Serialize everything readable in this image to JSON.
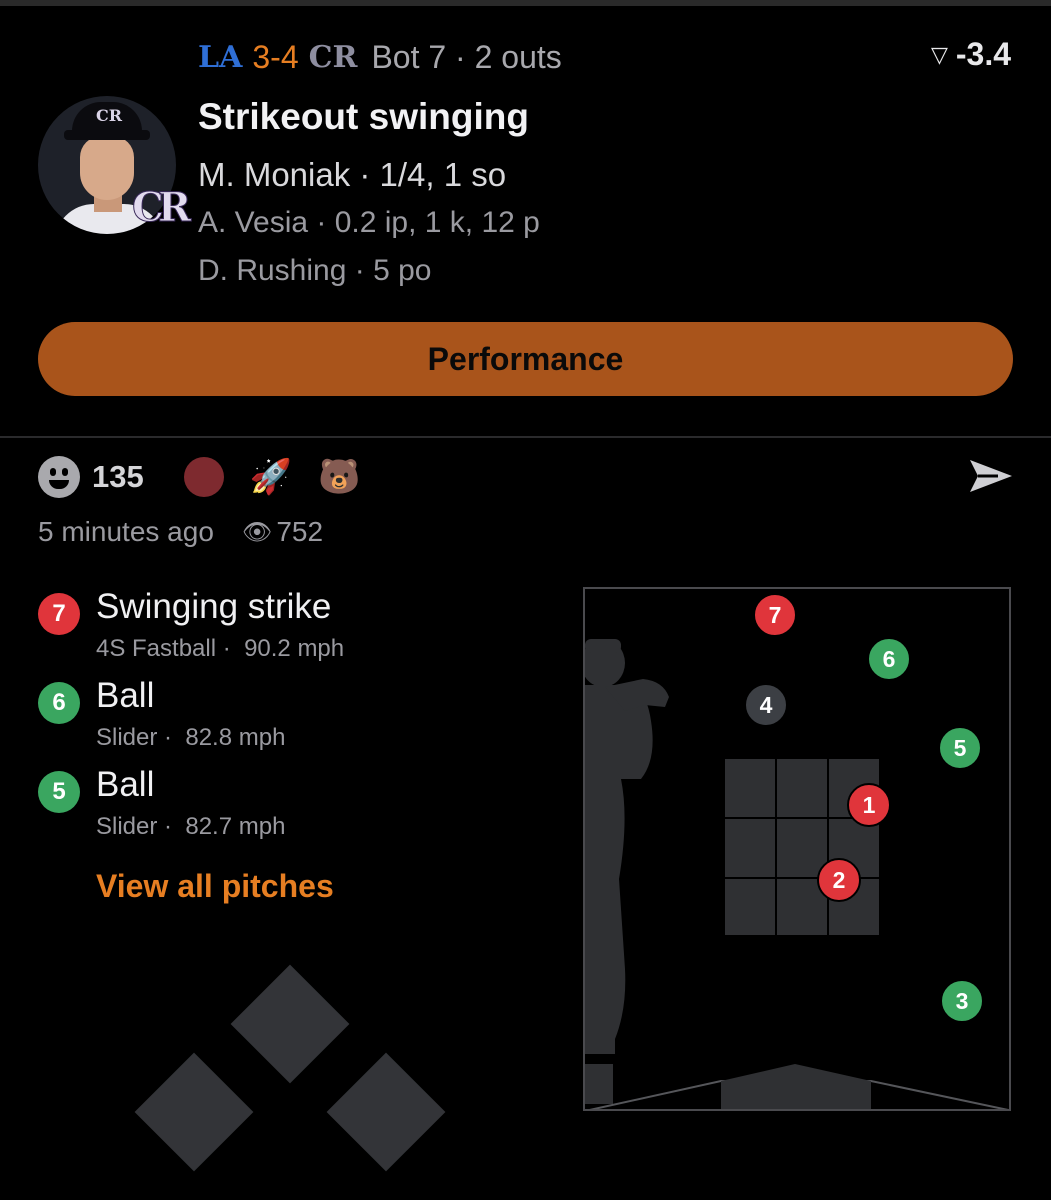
{
  "colors": {
    "accent": "#e67e22",
    "button_bg": "#a9541b",
    "strike_red": "#e0353b",
    "ball_green": "#3aa660",
    "inplay_gray": "#3c3f44",
    "zone_gray": "#2f3033",
    "reaction_red": "#7e2a2f"
  },
  "header": {
    "away_team_logo": "LA",
    "score": "3-4",
    "home_team_logo": "CR",
    "inning_info": "Bot 7 · 2 outs",
    "win_prob_icon": "win-probability-arrow-icon",
    "win_prob_delta": "-3.4"
  },
  "play": {
    "avatar_team_logo": "CR",
    "title": "Strikeout swinging",
    "batter_line": "M. Moniak · 1/4, 1 so",
    "pitcher_line": "A. Vesia · 0.2 ip, 1 k, 12 p",
    "fielder_line": "D. Rushing · 5 po"
  },
  "performance_button": "Performance",
  "social": {
    "reaction_count": "135",
    "emoji_rocket": "🚀",
    "emoji_mascot": "🐻",
    "time_ago": "5 minutes ago",
    "views_icon": "👁",
    "views": "752"
  },
  "pitches": [
    {
      "number": "7",
      "result": "Swinging strike",
      "pitch_type": "4S Fastball",
      "speed": "90.2 mph",
      "color": "#e0353b"
    },
    {
      "number": "6",
      "result": "Ball",
      "pitch_type": "Slider",
      "speed": "82.8 mph",
      "color": "#3aa660"
    },
    {
      "number": "5",
      "result": "Ball",
      "pitch_type": "Slider",
      "speed": "82.7 mph",
      "color": "#3aa660"
    }
  ],
  "view_all_label": "View all pitches",
  "zone_pitches": [
    {
      "number": "1",
      "color": "#e0353b"
    },
    {
      "number": "2",
      "color": "#e0353b"
    },
    {
      "number": "3",
      "color": "#3aa660"
    },
    {
      "number": "4",
      "color": "#3c3f44"
    },
    {
      "number": "5",
      "color": "#3aa660"
    },
    {
      "number": "6",
      "color": "#3aa660"
    },
    {
      "number": "7",
      "color": "#e0353b"
    }
  ]
}
